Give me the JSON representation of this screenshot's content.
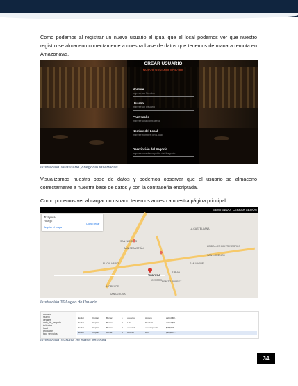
{
  "paragraphs": [
    "Como podemos al registrar un nuevo usuario al igual que el local podemos ver que nuestro registro se almaceno correctamente a nuestra base de datos que tenemos de manara remota en Amazonaws.",
    "Visualizamos nuestra base de datos y podemos observar que el usuario se almaceno correctamente a nuestra base de datos y con la contraseña encriptada.",
    "Como podemos ver al cargar un usuario tenemos acceso a nuestra página principal"
  ],
  "captions": {
    "fig34": "Ilustración 34 Usuario y negocio insertados.",
    "fig35": "Ilustración 35 Logeo de Usuario.",
    "fig36": "Ilustración 36 Base de datos en línea."
  },
  "create_user_form": {
    "title": "CREAR USUARIO",
    "error": "NUEVO USUARIO CREADO",
    "fields": [
      {
        "label": "Nombre",
        "placeholder": "Ingrese su Nombre"
      },
      {
        "label": "Usuario",
        "placeholder": "Ingrese un Usuario"
      },
      {
        "label": "Contraseña",
        "placeholder": "Ingrese una contraseña"
      },
      {
        "label": "Nombre del Local",
        "placeholder": "Ingrese nombre del Local"
      },
      {
        "label": "Descripción del Negocio",
        "placeholder": "Ingrese una descripción del Negocio"
      }
    ]
  },
  "map_page": {
    "nav": [
      "BIENVENIDO",
      "CERRAR SESIÓN"
    ],
    "place_title": "Tizayuca",
    "place_sub": "Hidalgo",
    "place_link": "Ampliar el mapa",
    "directions": "Cómo llegar",
    "labels": [
      "LA CASTELLANA",
      "SAN NICOLÁS",
      "SAN SEBASTIÁN",
      "LINDA LOS MONTENEGROS",
      "SAN LORENZO",
      "EL CALVARIO",
      "SAN MIGUEL",
      "ITALIA",
      "BENITO JUÁREZ",
      "MORELOS",
      "SANTA ROSA",
      "TIZAYUCA",
      "CENTRO"
    ]
  },
  "db_view": {
    "tree": [
      "usuario",
      "Nuevo",
      "detalles",
      "dato_de_negocio",
      "Articulos",
      "local",
      "productos",
      "tipo_servicios"
    ],
    "rows": [
      [
        "Editar",
        "Copiar",
        "Borrar",
        "1",
        "usuarioa",
        "Anders",
        "2a$10$U..."
      ],
      [
        "Editar",
        "Copiar",
        "Borrar",
        "2",
        "Luis",
        "Duc123",
        "2a$10$8f..."
      ],
      [
        "Editar",
        "Copiar",
        "Borrar",
        "3",
        "usuariob",
        "usuarioprueb",
        "$2b$10$..."
      ],
      [
        "Editar",
        "Copiar",
        "Borrar",
        "4",
        "Andres",
        "luis",
        "$2b$10$..."
      ]
    ]
  },
  "page_number": "34",
  "colors": {
    "header": "#10253f",
    "caption": "#6b7b91",
    "error": "#e04b2a"
  }
}
